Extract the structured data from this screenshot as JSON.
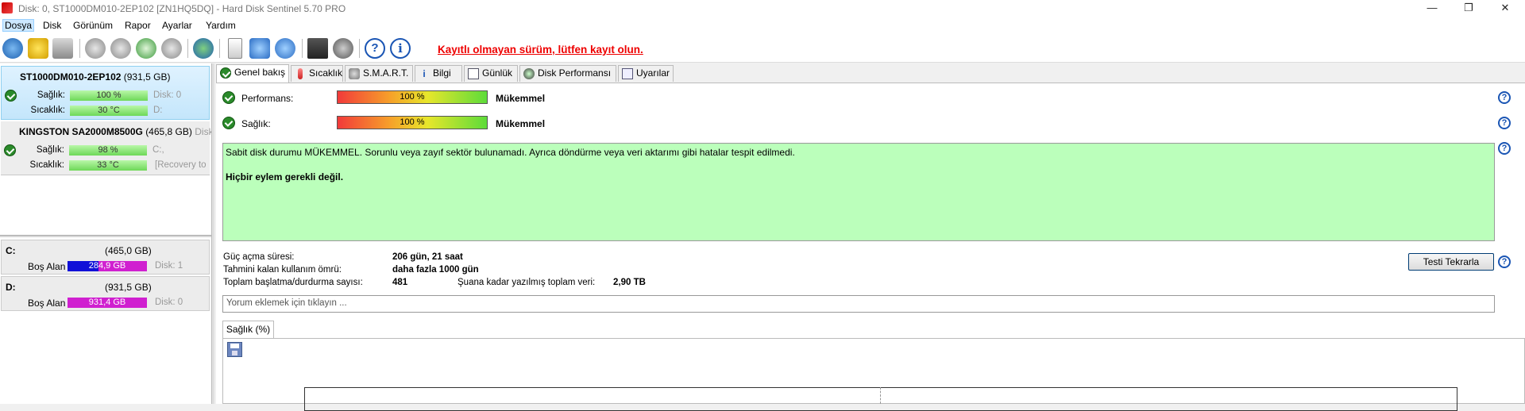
{
  "window": {
    "title": "Disk: 0, ST1000DM010-2EP102 [ZN1HQ5DQ]  -  Hard Disk Sentinel 5.70 PRO",
    "controls": {
      "minimize": "—",
      "maximize": "❐",
      "close": "✕"
    }
  },
  "menu": [
    "Dosya",
    "Disk",
    "Görünüm",
    "Rapor",
    "Ayarlar",
    "Yardım"
  ],
  "toolbar": {
    "icons": [
      "refresh-icon",
      "alert-icon",
      "disk-icon",
      "tool-icon-1",
      "tool-icon-2",
      "tool-icon-3",
      "tool-icon-4",
      "globe-icon",
      "report-icon",
      "send-report-icon",
      "network-icon",
      "performance-icon",
      "speaker-icon",
      "help-icon",
      "info-icon"
    ],
    "unregistered": "Kayıtlı olmayan sürüm, lütfen kayıt olun."
  },
  "disks": [
    {
      "name": "ST1000DM010-2EP102",
      "size": "(931,5 GB)",
      "health_label": "Sağlık:",
      "health_value": "100 %",
      "health_extra": "Disk: 0",
      "temp_label": "Sıcaklık:",
      "temp_value": "30 °C",
      "temp_extra": "D:"
    },
    {
      "name": "KINGSTON SA2000M8500G",
      "size": "(465,8 GB)",
      "size_extra": "Disk",
      "health_label": "Sağlık:",
      "health_value": "98 %",
      "health_extra": "C:,",
      "temp_label": "Sıcaklık:",
      "temp_value": "33 °C",
      "temp_extra": "[Recovery to"
    }
  ],
  "partitions": [
    {
      "letter": "C:",
      "size": "(465,0 GB)",
      "free_label": "Boş Alan",
      "free_value": "284,9 GB",
      "free_fraction": 0.61,
      "disk": "Disk: 1"
    },
    {
      "letter": "D:",
      "size": "(931,5 GB)",
      "free_label": "Boş Alan",
      "free_value": "931,4 GB",
      "free_fraction": 1.0,
      "disk": "Disk: 0"
    }
  ],
  "tabs": [
    "Genel bakış",
    "Sıcaklık",
    "S.M.A.R.T.",
    "Bilgi",
    "Günlük",
    "Disk Performansı",
    "Uyarılar"
  ],
  "overview": {
    "performance_label": "Performans:",
    "performance_value": "100 %",
    "performance_status": "Mükemmel",
    "health_label": "Sağlık:",
    "health_value": "100 %",
    "health_status": "Mükemmel",
    "message": "Sabit disk durumu MÜKEMMEL. Sorunlu veya zayıf sektör bulunamadı. Ayrıca döndürme veya veri aktarımı gibi hatalar tespit edilmedi.",
    "action": "Hiçbir eylem gerekli değil.",
    "power_on_label": "Güç açma süresi:",
    "power_on_value": "206 gün, 21 saat",
    "lifetime_label": "Tahmini kalan kullanım ömrü:",
    "lifetime_value": "daha fazla 1000 gün",
    "startstop_label": "Toplam başlatma/durdurma sayısı:",
    "startstop_value": "481",
    "written_label": "Şuana kadar yazılmış toplam veri:",
    "written_value": "2,90 TB",
    "retest_button": "Testi Tekrarla",
    "comment_placeholder": "Yorum eklemek için tıklayın ...",
    "chart_tab": "Sağlık (%)"
  },
  "colors": {
    "ok_green": "#bbffbb",
    "error_red": "#ee0000",
    "free_bar_c": "#1010d8",
    "free_bar_d": "#d020d0"
  }
}
